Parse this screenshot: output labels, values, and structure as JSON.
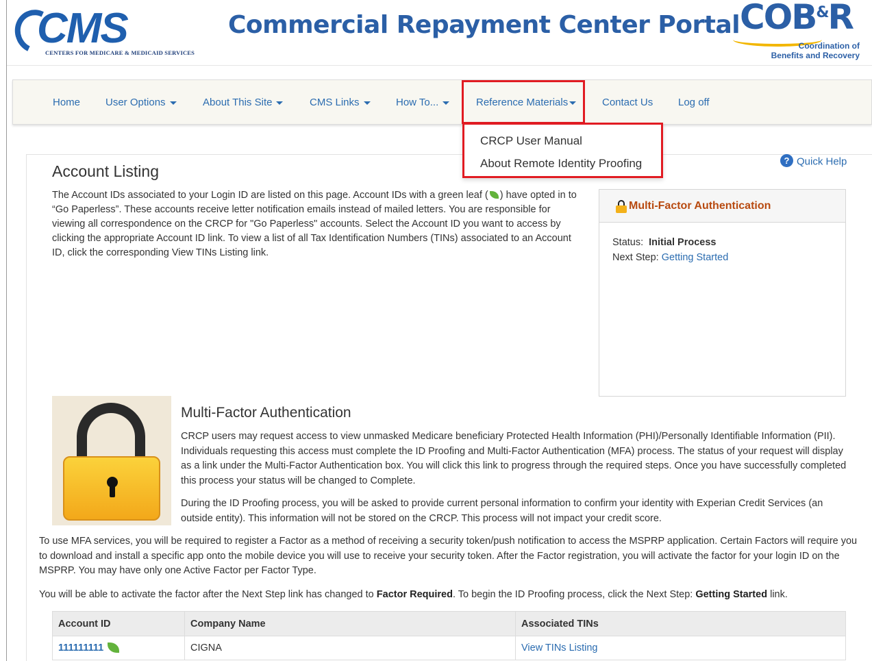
{
  "header": {
    "logo_left_text": "CMS",
    "logo_left_subtitle": "CENTERS FOR MEDICARE & MEDICAID SERVICES",
    "portal_title": "Commercial Repayment Center Portal",
    "logo_right_text": "COB",
    "logo_right_amp": "&",
    "logo_right_text_end": "R",
    "logo_right_sub1": "Coordination of",
    "logo_right_sub2": "Benefits and Recovery"
  },
  "nav": {
    "home": "Home",
    "user_options": "User Options",
    "about_site": "About This Site",
    "cms_links": "CMS Links",
    "how_to": "How To...",
    "reference_materials": "Reference Materials",
    "contact_us": "Contact Us",
    "log_off": "Log off"
  },
  "dropdown": {
    "items": [
      "CRCP User Manual",
      "About Remote Identity Proofing"
    ]
  },
  "page": {
    "title": "Account Listing",
    "quick_help": "Quick Help",
    "quick_help_icon": "?",
    "intro_part1": "The Account IDs associated to your Login ID are listed on this page. Account IDs with a green leaf (",
    "intro_part2": ") have opted in to “Go Paperless”. These accounts receive letter notification emails instead of mailed letters. You are responsible for viewing all correspondence on the CRCP for \"Go Paperless\" accounts. Select the Account ID you want to access by clicking the appropriate Account ID link. To view a list of all Tax Identification Numbers (TINs) associated to an Account ID, click the corresponding View TINs Listing link."
  },
  "mfa_box": {
    "title": "Multi-Factor Authentication",
    "status_label": "Status:",
    "status_value": "Initial Process",
    "next_step_label": "Next Step:",
    "next_step_link": "Getting Started"
  },
  "mfa_section": {
    "heading": "Multi-Factor Authentication",
    "para1": "CRCP users may request access to view unmasked Medicare beneficiary Protected Health Information (PHI)/Personally Identifiable Information (PII). Individuals requesting this access must complete the ID Proofing and Multi-Factor Authentication (MFA) process. The status of your request will display as a link under the Multi-Factor Authentication box. You will click this link to progress through the required steps. Once you have successfully completed this process your status will be changed to Complete.",
    "para2": "During the ID Proofing process, you will be asked to provide current personal information to confirm your identity with Experian Credit Services (an outside entity). This information will not be stored on the CRCP. This process will not impact your credit score.",
    "para3": "To use MFA services, you will be required to register a Factor as a method of receiving a security token/push notification to access the MSPRP application. Certain Factors will require you to download and install a specific app onto the mobile device you will use to receive your security token. After the Factor registration, you will activate the factor for your login ID on the MSPRP. You may have only one Active Factor per Factor Type.",
    "para4_a": "You will be able to activate the factor after the Next Step link has changed to ",
    "para4_b": "Factor Required",
    "para4_c": ". To begin the ID Proofing process, click the Next Step: ",
    "para4_d": "Getting Started",
    "para4_e": " link."
  },
  "table": {
    "headers": [
      "Account ID",
      "Company Name",
      "Associated TINs"
    ],
    "rows": [
      {
        "account_id": "111111111",
        "company": "CIGNA",
        "tins_link": "View TINs Listing"
      }
    ]
  },
  "colors": {
    "brand_blue": "#2b5fa6",
    "link_blue": "#2b6cb0",
    "highlight_red": "#e11b22",
    "mfa_title_orange": "#b84a10",
    "leaf_green": "#63b33c"
  }
}
